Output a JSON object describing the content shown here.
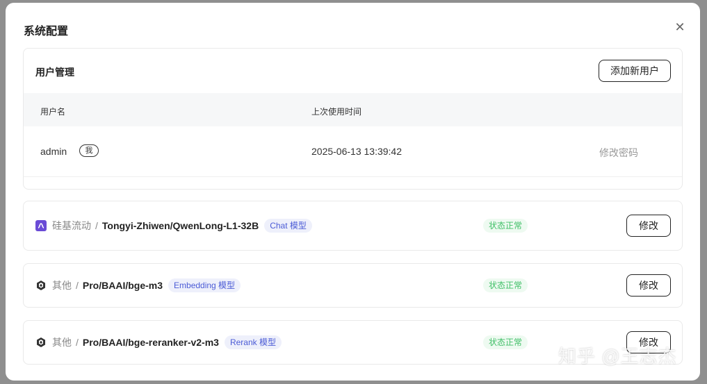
{
  "modal": {
    "title": "系统配置",
    "close_icon": "close-icon"
  },
  "user_section": {
    "title": "用户管理",
    "add_button": "添加新用户",
    "columns": [
      "用户名",
      "上次使用时间"
    ],
    "rows": [
      {
        "username": "admin",
        "badge": "我",
        "last_used": "2025-06-13 13:39:42",
        "action": "修改密码"
      }
    ]
  },
  "models": [
    {
      "icon": "siliconflow-icon",
      "provider": "硅基流动",
      "separator": "/",
      "name": "Tongyi-Zhiwen/QwenLong-L1-32B",
      "tag": "Chat 模型",
      "status": "状态正常",
      "action": "修改"
    },
    {
      "icon": "cube-icon",
      "provider": "其他",
      "separator": "/",
      "name": "Pro/BAAI/bge-m3",
      "tag": "Embedding 模型",
      "status": "状态正常",
      "action": "修改"
    },
    {
      "icon": "cube-icon",
      "provider": "其他",
      "separator": "/",
      "name": "Pro/BAAI/bge-reranker-v2-m3",
      "tag": "Rerank 模型",
      "status": "状态正常",
      "action": "修改"
    }
  ],
  "watermark": "知乎 @王志杰",
  "colors": {
    "tag_bg": "#eef0fb",
    "tag_text": "#4b5bd6",
    "status_bg": "#eefaf1",
    "status_text": "#3fbf66",
    "provider_icon": "#6a4bd6"
  }
}
